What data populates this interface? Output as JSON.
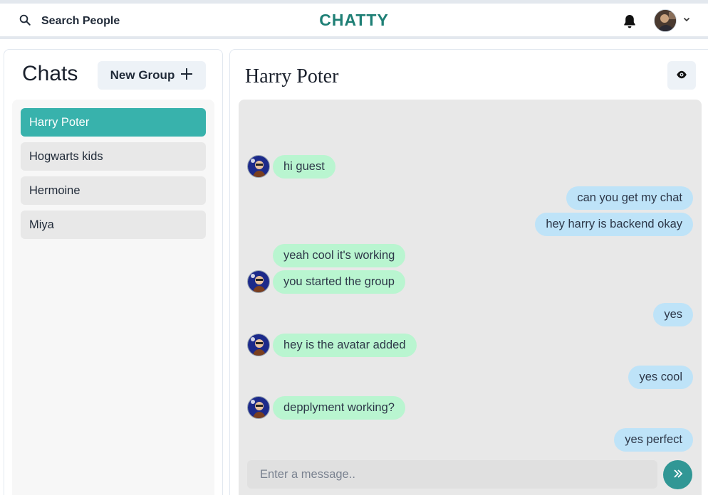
{
  "header": {
    "search_label": "Search People",
    "brand": "CHATTY",
    "icons": {
      "search": "search-icon",
      "bell": "bell-icon",
      "chevron": "chevron-down-icon"
    },
    "brand_color": "#1e7f75"
  },
  "sidebar": {
    "title": "Chats",
    "new_group_label": "New Group",
    "chats": [
      {
        "name": "Harry Poter",
        "active": true
      },
      {
        "name": "Hogwarts kids",
        "active": false
      },
      {
        "name": "Hermoine",
        "active": false
      },
      {
        "name": "Miya",
        "active": false
      }
    ],
    "accent": "#38b2ac"
  },
  "chat": {
    "title": "Harry Poter",
    "messages": [
      {
        "text": "hi guest",
        "sender": "other",
        "avatar": true
      },
      {
        "text": "can you get my chat",
        "sender": "self",
        "avatar": false
      },
      {
        "text": "hey harry is backend okay",
        "sender": "self",
        "avatar": false
      },
      {
        "text": "yeah cool it's working",
        "sender": "other",
        "avatar": false
      },
      {
        "text": "you started the group",
        "sender": "other",
        "avatar": true
      },
      {
        "text": "yes",
        "sender": "self",
        "avatar": false
      },
      {
        "text": "hey is the avatar added",
        "sender": "other",
        "avatar": true
      },
      {
        "text": "yes cool",
        "sender": "self",
        "avatar": false
      },
      {
        "text": "depplyment working?",
        "sender": "other",
        "avatar": true
      },
      {
        "text": "yes perfect",
        "sender": "self",
        "avatar": false
      }
    ],
    "input_placeholder": "Enter a message..",
    "colors": {
      "other_bubble": "#b9f5d0",
      "self_bubble": "#bee3f8",
      "send_button": "#319795"
    }
  }
}
